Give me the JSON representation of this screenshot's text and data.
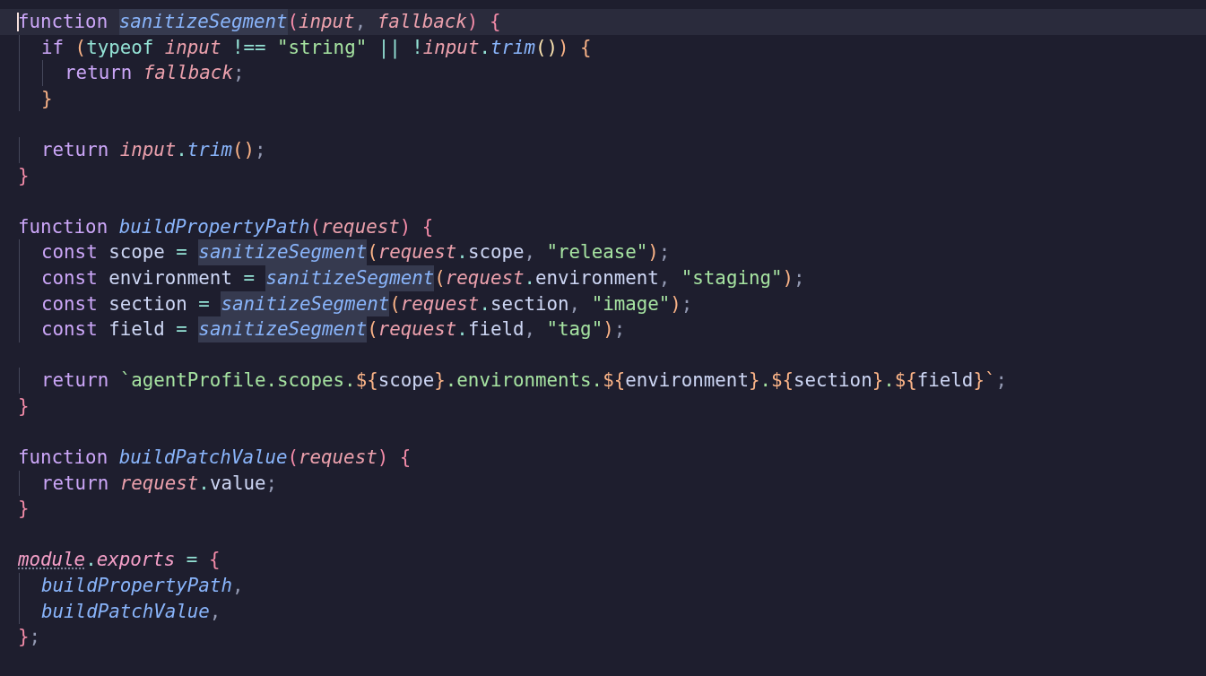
{
  "editor": {
    "lines": [
      {
        "current": true,
        "cursor": true,
        "tokens": [
          {
            "text": "function ",
            "kind": "kw"
          },
          {
            "text": "sanitizeSegment",
            "kind": "fn",
            "highlighted": true
          },
          {
            "text": "(",
            "kind": "br1"
          },
          {
            "text": "input",
            "kind": "param"
          },
          {
            "text": ", ",
            "kind": "punct"
          },
          {
            "text": "fallback",
            "kind": "param"
          },
          {
            "text": ") ",
            "kind": "br1"
          },
          {
            "text": "{",
            "kind": "br1"
          }
        ]
      },
      {
        "current": false,
        "cursor": false,
        "tokens": [
          {
            "text": "  if ",
            "kind": "kw"
          },
          {
            "text": "(",
            "kind": "br2"
          },
          {
            "text": "typeof ",
            "kind": "op"
          },
          {
            "text": "input ",
            "kind": "param"
          },
          {
            "text": "!== ",
            "kind": "op"
          },
          {
            "text": "\"string\" ",
            "kind": "str"
          },
          {
            "text": "|| !",
            "kind": "op"
          },
          {
            "text": "input",
            "kind": "param"
          },
          {
            "text": ".",
            "kind": "op"
          },
          {
            "text": "trim",
            "kind": "fn"
          },
          {
            "text": "()",
            "kind": "br3"
          },
          {
            "text": ") {",
            "kind": "br2"
          }
        ]
      },
      {
        "current": false,
        "cursor": false,
        "tokens": [
          {
            "text": "    return ",
            "kind": "kw"
          },
          {
            "text": "fallback",
            "kind": "param"
          },
          {
            "text": ";",
            "kind": "punct"
          }
        ]
      },
      {
        "current": false,
        "cursor": false,
        "tokens": [
          {
            "text": "  }",
            "kind": "br2"
          }
        ]
      },
      {
        "current": false,
        "cursor": false
      },
      {
        "current": false,
        "cursor": false,
        "tokens": [
          {
            "text": "  return ",
            "kind": "kw"
          },
          {
            "text": "input",
            "kind": "param"
          },
          {
            "text": ".",
            "kind": "op"
          },
          {
            "text": "trim",
            "kind": "fn"
          },
          {
            "text": "()",
            "kind": "br2"
          },
          {
            "text": ";",
            "kind": "punct"
          }
        ]
      },
      {
        "current": false,
        "cursor": false,
        "tokens": [
          {
            "text": "}",
            "kind": "br1"
          }
        ]
      },
      {
        "current": false,
        "cursor": false
      },
      {
        "current": false,
        "cursor": false,
        "tokens": [
          {
            "text": "function ",
            "kind": "kw"
          },
          {
            "text": "buildPropertyPath",
            "kind": "fn"
          },
          {
            "text": "(",
            "kind": "br1"
          },
          {
            "text": "request",
            "kind": "param"
          },
          {
            "text": ") {",
            "kind": "br1"
          }
        ]
      },
      {
        "current": false,
        "cursor": false,
        "tokens": [
          {
            "text": "  const",
            "kind": "kw"
          },
          {
            "text": " scope ",
            "kind": "text"
          },
          {
            "text": "= ",
            "kind": "op"
          },
          {
            "text": "sanitizeSegment",
            "kind": "fn",
            "highlighted": true
          },
          {
            "text": "(",
            "kind": "br2"
          },
          {
            "text": "request",
            "kind": "param"
          },
          {
            "text": ".",
            "kind": "op"
          },
          {
            "text": "scope",
            "kind": "text"
          },
          {
            "text": ", ",
            "kind": "punct"
          },
          {
            "text": "\"release\"",
            "kind": "str"
          },
          {
            "text": ")",
            "kind": "br2"
          },
          {
            "text": ";",
            "kind": "punct"
          }
        ]
      },
      {
        "current": false,
        "cursor": false,
        "tokens": [
          {
            "text": "  const",
            "kind": "kw"
          },
          {
            "text": " environment ",
            "kind": "text"
          },
          {
            "text": "= ",
            "kind": "op"
          },
          {
            "text": "sanitizeSegment",
            "kind": "fn",
            "highlighted": true
          },
          {
            "text": "(",
            "kind": "br2"
          },
          {
            "text": "request",
            "kind": "param"
          },
          {
            "text": ".",
            "kind": "op"
          },
          {
            "text": "environment",
            "kind": "text"
          },
          {
            "text": ", ",
            "kind": "punct"
          },
          {
            "text": "\"staging\"",
            "kind": "str"
          },
          {
            "text": ")",
            "kind": "br2"
          },
          {
            "text": ";",
            "kind": "punct"
          }
        ]
      },
      {
        "current": false,
        "cursor": false,
        "tokens": [
          {
            "text": "  const",
            "kind": "kw"
          },
          {
            "text": " section ",
            "kind": "text"
          },
          {
            "text": "= ",
            "kind": "op"
          },
          {
            "text": "sanitizeSegment",
            "kind": "fn",
            "highlighted": true
          },
          {
            "text": "(",
            "kind": "br2"
          },
          {
            "text": "request",
            "kind": "param"
          },
          {
            "text": ".",
            "kind": "op"
          },
          {
            "text": "section",
            "kind": "text"
          },
          {
            "text": ", ",
            "kind": "punct"
          },
          {
            "text": "\"image\"",
            "kind": "str"
          },
          {
            "text": ")",
            "kind": "br2"
          },
          {
            "text": ";",
            "kind": "punct"
          }
        ]
      },
      {
        "current": false,
        "cursor": false,
        "tokens": [
          {
            "text": "  const",
            "kind": "kw"
          },
          {
            "text": " field ",
            "kind": "text"
          },
          {
            "text": "= ",
            "kind": "op"
          },
          {
            "text": "sanitizeSegment",
            "kind": "fn",
            "highlighted": true
          },
          {
            "text": "(",
            "kind": "br2"
          },
          {
            "text": "request",
            "kind": "param"
          },
          {
            "text": ".",
            "kind": "op"
          },
          {
            "text": "field",
            "kind": "text"
          },
          {
            "text": ", ",
            "kind": "punct"
          },
          {
            "text": "\"tag\"",
            "kind": "str"
          },
          {
            "text": ")",
            "kind": "br2"
          },
          {
            "text": ";",
            "kind": "punct"
          }
        ]
      },
      {
        "current": false,
        "cursor": false
      },
      {
        "current": false,
        "cursor": false,
        "tokens": [
          {
            "text": "  return ",
            "kind": "kw"
          },
          {
            "text": "`agentProfile.scopes.",
            "kind": "str"
          },
          {
            "text": "${",
            "kind": "br2"
          },
          {
            "text": "scope",
            "kind": "text"
          },
          {
            "text": "}",
            "kind": "br2"
          },
          {
            "text": ".environments.",
            "kind": "str"
          },
          {
            "text": "${",
            "kind": "br2"
          },
          {
            "text": "environment",
            "kind": "text"
          },
          {
            "text": "}",
            "kind": "br2"
          },
          {
            "text": ".",
            "kind": "str"
          },
          {
            "text": "${",
            "kind": "br2"
          },
          {
            "text": "section",
            "kind": "text"
          },
          {
            "text": "}",
            "kind": "br2"
          },
          {
            "text": ".",
            "kind": "str"
          },
          {
            "text": "${",
            "kind": "br2"
          },
          {
            "text": "field",
            "kind": "text"
          },
          {
            "text": "}`",
            "kind": "br2"
          },
          {
            "text": ";",
            "kind": "punct"
          }
        ]
      },
      {
        "current": false,
        "cursor": false,
        "tokens": [
          {
            "text": "}",
            "kind": "br1"
          }
        ]
      },
      {
        "current": false,
        "cursor": false
      },
      {
        "current": false,
        "cursor": false,
        "tokens": [
          {
            "text": "function ",
            "kind": "kw"
          },
          {
            "text": "buildPatchValue",
            "kind": "fn"
          },
          {
            "text": "(",
            "kind": "br1"
          },
          {
            "text": "request",
            "kind": "param"
          },
          {
            "text": ") {",
            "kind": "br1"
          }
        ]
      },
      {
        "current": false,
        "cursor": false,
        "tokens": [
          {
            "text": "  return ",
            "kind": "kw"
          },
          {
            "text": "request",
            "kind": "param"
          },
          {
            "text": ".",
            "kind": "op"
          },
          {
            "text": "value",
            "kind": "text"
          },
          {
            "text": ";",
            "kind": "punct"
          }
        ]
      },
      {
        "current": false,
        "cursor": false,
        "tokens": [
          {
            "text": "}",
            "kind": "br1"
          }
        ]
      },
      {
        "current": false,
        "cursor": false
      },
      {
        "current": false,
        "cursor": false,
        "tokens": [
          {
            "text": "module",
            "kind": "builtin",
            "hint": true
          },
          {
            "text": ".",
            "kind": "op"
          },
          {
            "text": "exports ",
            "kind": "builtin"
          },
          {
            "text": "= ",
            "kind": "op"
          },
          {
            "text": "{",
            "kind": "br1"
          }
        ]
      },
      {
        "current": false,
        "cursor": false,
        "tokens": [
          {
            "text": "  buildPropertyPath",
            "kind": "fn"
          },
          {
            "text": ",",
            "kind": "punct"
          }
        ]
      },
      {
        "current": false,
        "cursor": false,
        "tokens": [
          {
            "text": "  buildPatchValue",
            "kind": "fn"
          },
          {
            "text": ",",
            "kind": "punct"
          }
        ]
      },
      {
        "current": false,
        "cursor": false,
        "tokens": [
          {
            "text": "}",
            "kind": "br1"
          },
          {
            "text": ";",
            "kind": "punct"
          }
        ]
      }
    ]
  }
}
